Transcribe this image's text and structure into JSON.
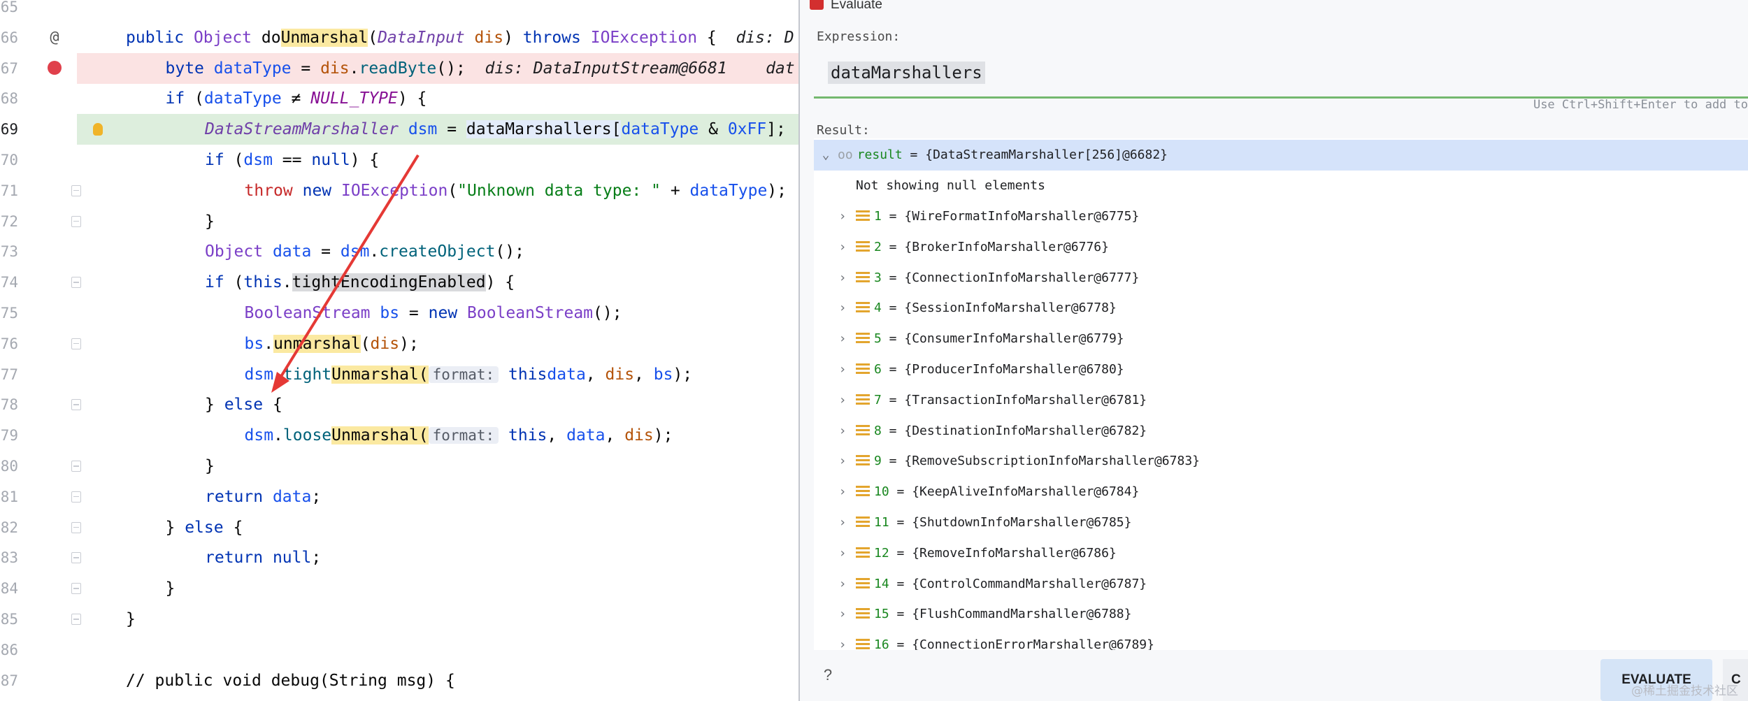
{
  "editor": {
    "lines": [
      {
        "num": "65"
      },
      {
        "num": "66",
        "gutter": "@",
        "parts": [
          [
            "kw",
            "public "
          ],
          [
            "ty",
            "Object "
          ],
          [
            "",
            "do"
          ],
          [
            "hlY",
            "Unmarshal"
          ],
          [
            "",
            "("
          ],
          [
            "tyi",
            "DataInput"
          ],
          [
            "",
            " "
          ],
          [
            "pr",
            "dis"
          ],
          [
            "",
            ") "
          ],
          [
            "kw",
            "throws "
          ],
          [
            "ty",
            "IOException"
          ],
          [
            "",
            " {  "
          ],
          [
            "hint",
            "dis: D"
          ]
        ]
      },
      {
        "num": "67",
        "bg": "#fbe3e3",
        "gutter": "bp",
        "parts": [
          [
            "kw",
            "byte "
          ],
          [
            "vr",
            "dataType"
          ],
          [
            "",
            " = "
          ],
          [
            "pr",
            "dis"
          ],
          [
            "",
            "."
          ],
          [
            "mt",
            "readByte"
          ],
          [
            "",
            "();  "
          ],
          [
            "hint",
            "dis: DataInputStream@6681    dat"
          ]
        ]
      },
      {
        "num": "68",
        "parts": [
          [
            "kw",
            "if "
          ],
          [
            "",
            "("
          ],
          [
            "vr",
            "dataType"
          ],
          [
            "",
            " ≠ "
          ],
          [
            "fld",
            "NULL_TYPE"
          ],
          [
            "",
            ") {"
          ]
        ]
      },
      {
        "num": "69",
        "bg": "#ddeedd",
        "current": true,
        "gutter": "bulb",
        "parts": [
          [
            "tyi",
            "DataStreamMarshaller"
          ],
          [
            "",
            " "
          ],
          [
            "vr",
            "dsm"
          ],
          [
            "",
            " = "
          ],
          [
            "hlB",
            "dataMarshallers"
          ],
          [
            "hlB",
            "["
          ],
          [
            "vr",
            "dataType"
          ],
          [
            "",
            " & "
          ],
          [
            "nm",
            "0xFF"
          ],
          [
            "",
            "];"
          ]
        ]
      },
      {
        "num": "70",
        "indent": 2,
        "parts": [
          [
            "kw",
            "if "
          ],
          [
            "",
            "("
          ],
          [
            "vr",
            "dsm"
          ],
          [
            "",
            " == "
          ],
          [
            "kw",
            "null"
          ],
          [
            "",
            ") {"
          ]
        ]
      },
      {
        "num": "71",
        "indent": 3,
        "parts": [
          [
            "kw2",
            "throw "
          ],
          [
            "kw",
            "new "
          ],
          [
            "ty",
            "IOException"
          ],
          [
            "",
            "("
          ],
          [
            "st",
            "\"Unknown data type: \""
          ],
          [
            "",
            " + "
          ],
          [
            "vr",
            "dataType"
          ],
          [
            "",
            ");"
          ]
        ]
      },
      {
        "num": "72",
        "indent": 2,
        "parts": [
          [
            "",
            "}"
          ]
        ]
      },
      {
        "num": "73",
        "indent": 2,
        "parts": [
          [
            "ty",
            "Object "
          ],
          [
            "vr",
            "data"
          ],
          [
            "",
            " = "
          ],
          [
            "vr",
            "dsm"
          ],
          [
            "",
            "."
          ],
          [
            "mt",
            "createObject"
          ],
          [
            "",
            "();"
          ]
        ]
      },
      {
        "num": "74",
        "indent": 2,
        "parts": [
          [
            "kw",
            "if "
          ],
          [
            "",
            "("
          ],
          [
            "kw",
            "this"
          ],
          [
            "",
            "."
          ],
          [
            "hlG",
            "tightEncodingEnabled"
          ],
          [
            "",
            ") {"
          ]
        ]
      },
      {
        "num": "75",
        "indent": 3,
        "parts": [
          [
            "ty",
            "BooleanStream "
          ],
          [
            "vr",
            "bs"
          ],
          [
            "",
            " = "
          ],
          [
            "kw",
            "new "
          ],
          [
            "ty",
            "BooleanStream"
          ],
          [
            "",
            "();"
          ]
        ]
      },
      {
        "num": "76",
        "indent": 3,
        "parts": [
          [
            "vr",
            "bs"
          ],
          [
            "",
            "."
          ],
          [
            "hlY",
            "unmarshal"
          ],
          [
            "",
            "("
          ],
          [
            "pr",
            "dis"
          ],
          [
            "",
            ");"
          ]
        ]
      },
      {
        "num": "77",
        "indent": 3,
        "parts": [
          [
            "vr",
            "dsm"
          ],
          [
            "",
            "."
          ],
          [
            "mt",
            "tight"
          ],
          [
            "hlY",
            "Unmarshal("
          ],
          [
            "phint",
            "format:"
          ],
          [
            "",
            " "
          ],
          [
            "kw",
            "this"
          ],
          [
            ", ",
            ""
          ],
          [
            "vr",
            "data"
          ],
          [
            "",
            ", "
          ],
          [
            "pr",
            "dis"
          ],
          [
            "",
            ", "
          ],
          [
            "vr",
            "bs"
          ],
          [
            "",
            ");"
          ]
        ]
      },
      {
        "num": "78",
        "indent": 2,
        "parts": [
          [
            "",
            "} "
          ],
          [
            "kw",
            "else "
          ],
          [
            "",
            "{"
          ]
        ]
      },
      {
        "num": "79",
        "indent": 3,
        "parts": [
          [
            "vr",
            "dsm"
          ],
          [
            "",
            "."
          ],
          [
            "mt",
            "loose"
          ],
          [
            "hlY",
            "Unmarshal("
          ],
          [
            "phint",
            "format:"
          ],
          [
            "",
            " "
          ],
          [
            "kw",
            "this"
          ],
          [
            "",
            ", "
          ],
          [
            "vr",
            "data"
          ],
          [
            "",
            ", "
          ],
          [
            "pr",
            "dis"
          ],
          [
            "",
            ");"
          ]
        ]
      },
      {
        "num": "80",
        "indent": 2,
        "parts": [
          [
            "",
            "}"
          ]
        ]
      },
      {
        "num": "81",
        "indent": 2,
        "parts": [
          [
            "kw",
            "return "
          ],
          [
            "vr",
            "data"
          ],
          [
            "",
            ";"
          ]
        ]
      },
      {
        "num": "82",
        "indent": 1,
        "parts": [
          [
            "",
            "} "
          ],
          [
            "kw",
            "else "
          ],
          [
            "",
            "{"
          ]
        ]
      },
      {
        "num": "83",
        "indent": 2,
        "parts": [
          [
            "kw",
            "return "
          ],
          [
            "kw",
            "null"
          ],
          [
            "",
            ";"
          ]
        ]
      },
      {
        "num": "84",
        "indent": 1,
        "parts": [
          [
            "",
            "}"
          ]
        ]
      },
      {
        "num": "85",
        "indent": 0,
        "parts": [
          [
            "",
            "}"
          ]
        ]
      },
      {
        "num": "86"
      },
      {
        "num": "87",
        "indent": 0,
        "parts": [
          [
            "",
            "// public void debug(String msg) {"
          ]
        ]
      }
    ]
  },
  "dialog": {
    "title": "Evaluate",
    "expression_label": "Expression:",
    "expression_value": "dataMarshallers",
    "hint": "Use Ctrl+Shift+Enter to add to",
    "result_label": "Result:",
    "result_name": "result",
    "result_value": " = {DataStreamMarshaller[256]@6682}",
    "null_note": "Not showing null elements",
    "items": [
      {
        "i": "1",
        "v": " = {WireFormatInfoMarshaller@6775}"
      },
      {
        "i": "2",
        "v": " = {BrokerInfoMarshaller@6776}"
      },
      {
        "i": "3",
        "v": " = {ConnectionInfoMarshaller@6777}"
      },
      {
        "i": "4",
        "v": " = {SessionInfoMarshaller@6778}"
      },
      {
        "i": "5",
        "v": " = {ConsumerInfoMarshaller@6779}"
      },
      {
        "i": "6",
        "v": " = {ProducerInfoMarshaller@6780}"
      },
      {
        "i": "7",
        "v": " = {TransactionInfoMarshaller@6781}"
      },
      {
        "i": "8",
        "v": " = {DestinationInfoMarshaller@6782}"
      },
      {
        "i": "9",
        "v": " = {RemoveSubscriptionInfoMarshaller@6783}"
      },
      {
        "i": "10",
        "v": " = {KeepAliveInfoMarshaller@6784}"
      },
      {
        "i": "11",
        "v": " = {ShutdownInfoMarshaller@6785}"
      },
      {
        "i": "12",
        "v": " = {RemoveInfoMarshaller@6786}"
      },
      {
        "i": "14",
        "v": " = {ControlCommandMarshaller@6787}"
      },
      {
        "i": "15",
        "v": " = {FlushCommandMarshaller@6788}"
      },
      {
        "i": "16",
        "v": " = {ConnectionErrorMarshaller@6789}"
      }
    ],
    "help": "?",
    "evaluate_button": "EVALUATE",
    "close_button": "C",
    "watermark": "@稀土掘金技术社区"
  }
}
